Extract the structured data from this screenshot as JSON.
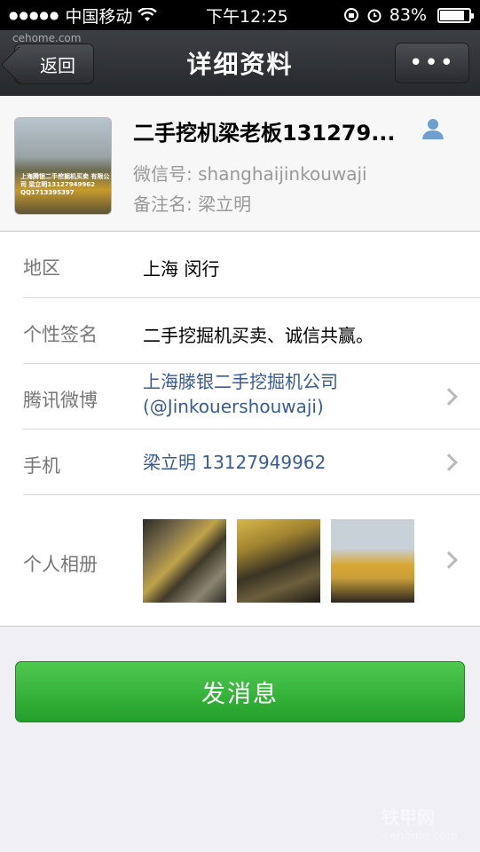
{
  "status": {
    "carrier": "中国移动",
    "time": "下午12:25",
    "battery": "83%",
    "battery_level": 0.83
  },
  "nav": {
    "back_label": "返回",
    "title": "详细资料",
    "more_label": "•••"
  },
  "profile": {
    "nickname": "二手挖机梁老板131279...",
    "wechat_id_label": "微信号:",
    "wechat_id": "shanghaijinkouwaji",
    "remark_label": "备注名:",
    "remark": "梁立明",
    "avatar_caption": "上海腾银二手挖掘机买卖 有限公司 梁立明13127949962 QQ1713395397"
  },
  "details": {
    "region_label": "地区",
    "region": "上海 闵行",
    "signature_label": "个性签名",
    "signature": "二手挖掘机买卖、诚信共赢。",
    "weibo_label": "腾讯微博",
    "weibo_line1": "上海滕银二手挖掘机公司",
    "weibo_line2": "(@Jinkouershouwaji)",
    "phone_label": "手机",
    "phone": "梁立明 13127949962",
    "album_label": "个人相册"
  },
  "actions": {
    "send_message": "发消息"
  },
  "watermarks": {
    "top": "cehome.com",
    "bottom_brand": "铁甲网",
    "bottom_site": "cehome.com"
  }
}
